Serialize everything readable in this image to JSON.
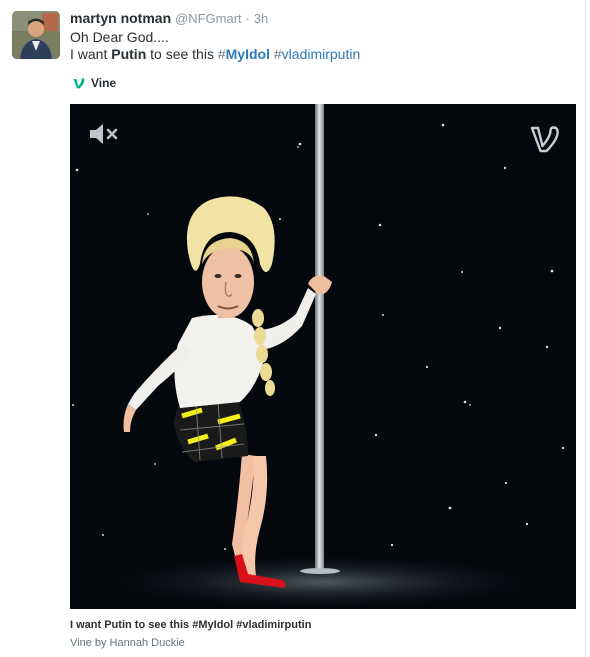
{
  "tweet": {
    "author_name": "martyn notman",
    "author_handle": "@NFGmart",
    "separator": "·",
    "timestamp": "3h",
    "line1": "Oh Dear God....",
    "line2_prefix": "I want ",
    "line2_strong": "Putin",
    "line2_mid": " to see this ",
    "hashtag1_symbol": "#",
    "hashtag1_text": "MyIdol",
    "hashtag2_symbol": "#",
    "hashtag2_text": "vladimirputin"
  },
  "card": {
    "source_label": "Vine",
    "source_icon": "vine-logo-icon",
    "mute_icon": "speaker-muted-icon",
    "video_description": "animated dancer with pole on starry background",
    "caption": "I want Putin to see this #MyIdol #vladimirputin",
    "byline": "Vine by Hannah Duckie"
  },
  "colors": {
    "link": "#2b7bb9",
    "vine_green": "#00b488",
    "video_bg": "#05080d"
  }
}
